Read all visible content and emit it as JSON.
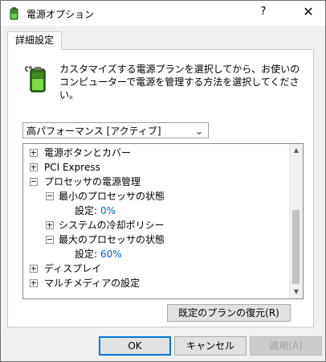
{
  "window": {
    "title": "電源オプション",
    "help_glyph": "?",
    "close_glyph": "✕"
  },
  "tabs": [
    {
      "label": "詳細設定"
    }
  ],
  "description": "カスタマイズする電源プランを選択してから、お使いのコンピューターで電源を管理する方法を選択してください。",
  "plan_select": {
    "value": "高パフォーマンス [アクティブ]"
  },
  "tree": {
    "power_buttons": "電源ボタンとカバー",
    "pci_express": "PCI Express",
    "processor_power": "プロセッサの電源管理",
    "min_state": {
      "label": "最小のプロセッサの状態",
      "setting_label": "設定:",
      "value": "0%"
    },
    "cooling_policy": "システムの冷却ポリシー",
    "max_state": {
      "label": "最大のプロセッサの状態",
      "setting_label": "設定:",
      "value": "60%"
    },
    "display": "ディスプレイ",
    "multimedia": "マルチメディアの設定"
  },
  "buttons": {
    "restore": "既定のプランの復元(R)",
    "ok": "OK",
    "cancel": "キャンセル",
    "apply": "適用(A)"
  },
  "colors": {
    "accent": "#0078d7",
    "value_text": "#0066cc"
  }
}
